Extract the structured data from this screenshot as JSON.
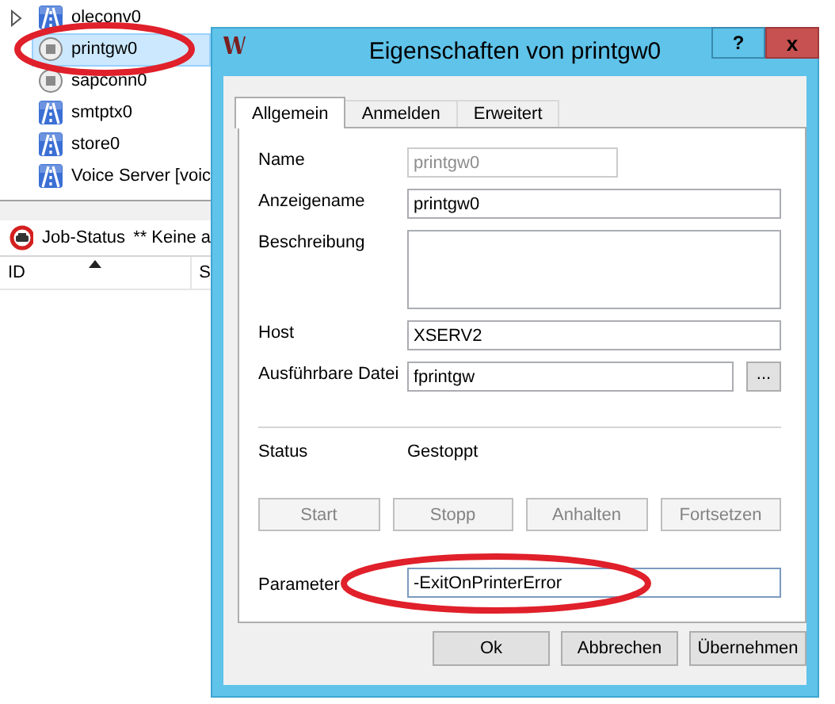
{
  "app": {
    "tree": [
      {
        "label": "oleconv0",
        "kind": "running",
        "expandable": true,
        "selected": false
      },
      {
        "label": "printgw0",
        "kind": "stopped",
        "expandable": false,
        "selected": true
      },
      {
        "label": "sapconn0",
        "kind": "stopped",
        "expandable": false,
        "selected": false
      },
      {
        "label": "smtptx0",
        "kind": "running",
        "expandable": false,
        "selected": false
      },
      {
        "label": "store0",
        "kind": "running",
        "expandable": false,
        "selected": false
      },
      {
        "label": "Voice Server [voic",
        "kind": "running",
        "expandable": false,
        "selected": false
      }
    ],
    "job_status": {
      "label": "Job-Status",
      "message": "** Keine a"
    },
    "table": {
      "columns": [
        {
          "label": "ID",
          "sorted": true
        },
        {
          "label": "S",
          "sorted": false
        }
      ]
    }
  },
  "dialog": {
    "title": "Eigenschaften von printgw0",
    "help_button": "?",
    "close_button": "x",
    "tabs": [
      {
        "label": "Allgemein",
        "selected": true
      },
      {
        "label": "Anmelden",
        "selected": false
      },
      {
        "label": "Erweitert",
        "selected": false
      }
    ],
    "fields": [
      {
        "kind": "text",
        "label": "Name",
        "value": "printgw0",
        "disabled": true
      },
      {
        "kind": "text",
        "label": "Anzeigename",
        "value": "printgw0",
        "disabled": false
      },
      {
        "kind": "textarea",
        "label": "Beschreibung",
        "disabled": false
      },
      {
        "kind": "text",
        "label": "Host",
        "value": "XSERV2",
        "disabled": false
      },
      {
        "kind": "file",
        "label": "Ausführbare Datei",
        "value": "fprintgw",
        "browse_button": "...",
        "disabled": false
      }
    ],
    "status": {
      "label": "Status",
      "value": "Gestoppt"
    },
    "actions": [
      {
        "label": "Start",
        "disabled": true
      },
      {
        "label": "Stopp",
        "disabled": true
      },
      {
        "label": "Anhalten",
        "disabled": true
      },
      {
        "label": "Fortsetzen",
        "disabled": true
      }
    ],
    "parameter": {
      "label": "Parameter",
      "value": "-ExitOnPrinterError"
    },
    "buttons": [
      "Ok",
      "Abbrechen",
      "Übernehmen"
    ]
  }
}
